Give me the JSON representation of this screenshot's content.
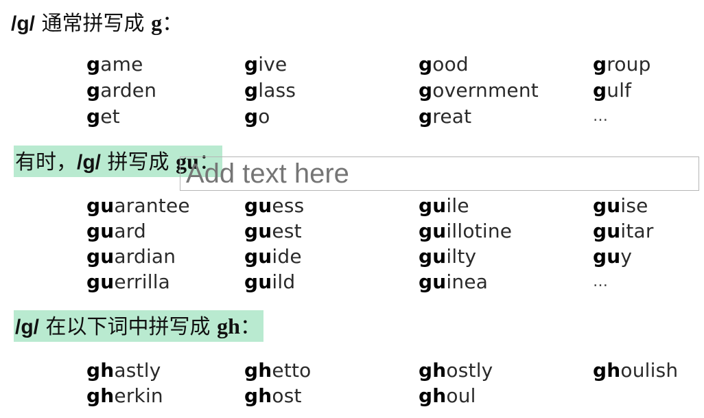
{
  "sections": [
    {
      "ipa": "/g/",
      "text": " 通常拼写成 ",
      "spelling": "g",
      "colon": "：",
      "rows": [
        [
          {
            "b": "g",
            "r": "ame"
          },
          {
            "b": "g",
            "r": "ive"
          },
          {
            "b": "g",
            "r": "ood"
          },
          {
            "b": "g",
            "r": "roup"
          }
        ],
        [
          {
            "b": "g",
            "r": "arden"
          },
          {
            "b": "g",
            "r": "lass"
          },
          {
            "b": "g",
            "r": "overnment"
          },
          {
            "b": "g",
            "r": "ulf"
          }
        ],
        [
          {
            "b": "g",
            "r": "et"
          },
          {
            "b": "g",
            "r": "o"
          },
          {
            "b": "g",
            "r": "reat"
          },
          {
            "b": "",
            "r": "…"
          }
        ]
      ]
    },
    {
      "prefix": "有时，",
      "ipa": "/g/",
      "text": " 拼写成 ",
      "spelling": "gu",
      "colon": "：",
      "highlight_color": "#b9ead0",
      "rows": [
        [
          {
            "b": "gu",
            "r": "arantee"
          },
          {
            "b": "gu",
            "r": "ess"
          },
          {
            "b": "gu",
            "r": "ile"
          },
          {
            "b": "gu",
            "r": "ise"
          }
        ],
        [
          {
            "b": "gu",
            "r": "ard"
          },
          {
            "b": "gu",
            "r": "est"
          },
          {
            "b": "gu",
            "r": "illotine"
          },
          {
            "b": "gu",
            "r": "itar"
          }
        ],
        [
          {
            "b": "gu",
            "r": "ardian"
          },
          {
            "b": "gu",
            "r": "ide"
          },
          {
            "b": "gu",
            "r": "ilty"
          },
          {
            "b": "gu",
            "r": "y"
          }
        ],
        [
          {
            "b": "gu",
            "r": "errilla"
          },
          {
            "b": "gu",
            "r": "ild"
          },
          {
            "b": "gu",
            "r": "inea"
          },
          {
            "b": "",
            "r": "…"
          }
        ]
      ]
    },
    {
      "ipa": "/g/",
      "text": " 在以下词中拼写成 ",
      "spelling": "gh",
      "colon": "：",
      "highlight_color": "#b9ead0",
      "rows": [
        [
          {
            "b": "gh",
            "r": "astly"
          },
          {
            "b": "gh",
            "r": "etto"
          },
          {
            "b": "gh",
            "r": "ostly"
          },
          {
            "b": "gh",
            "r": "oulish"
          }
        ],
        [
          {
            "b": "gh",
            "r": "erkin"
          },
          {
            "b": "gh",
            "r": "ost"
          },
          {
            "b": "gh",
            "r": "oul"
          }
        ]
      ]
    }
  ],
  "textbox": {
    "placeholder": "Add text here",
    "value": ""
  }
}
